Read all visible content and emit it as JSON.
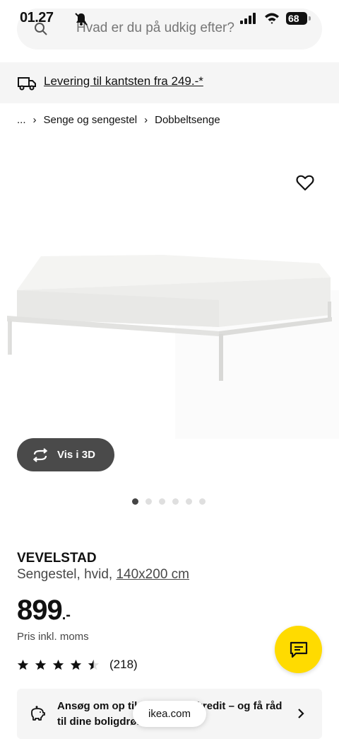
{
  "status_bar": {
    "time": "01.27",
    "battery": "68"
  },
  "search": {
    "placeholder": "Hvad er du på udkig efter?"
  },
  "delivery_banner": {
    "text": "Levering til kantsten fra 249.-*"
  },
  "breadcrumb": {
    "ellipsis": "...",
    "items": [
      "Senge og sengestel",
      "Dobbeltsenge"
    ]
  },
  "view_3d": {
    "label": "Vis i 3D"
  },
  "carousel": {
    "count": 6,
    "active": 1
  },
  "product": {
    "name": "VEVELSTAD",
    "description": "Sengestel, hvid, ",
    "size": "140x200 cm",
    "price": "899",
    "price_suffix": ".-",
    "price_note": "Pris inkl. moms",
    "rating": 4.5,
    "rating_count": "(218)"
  },
  "credit": {
    "text": "Ansøg om op til 15.000 kr. i kredit – og få råd til dine boligdrømme"
  },
  "browser": {
    "url": "ikea.com"
  },
  "colors": {
    "brand_yellow": "#ffdb00",
    "surface_gray": "#f5f5f5",
    "button_dark": "#4a4a4a"
  },
  "icons": [
    "search-icon",
    "bell-off-icon",
    "signal-icon",
    "wifi-icon",
    "truck-icon",
    "heart-icon",
    "rotate-icon",
    "star-icon",
    "chat-icon",
    "piggy-bank-icon",
    "chevron-right-icon"
  ]
}
